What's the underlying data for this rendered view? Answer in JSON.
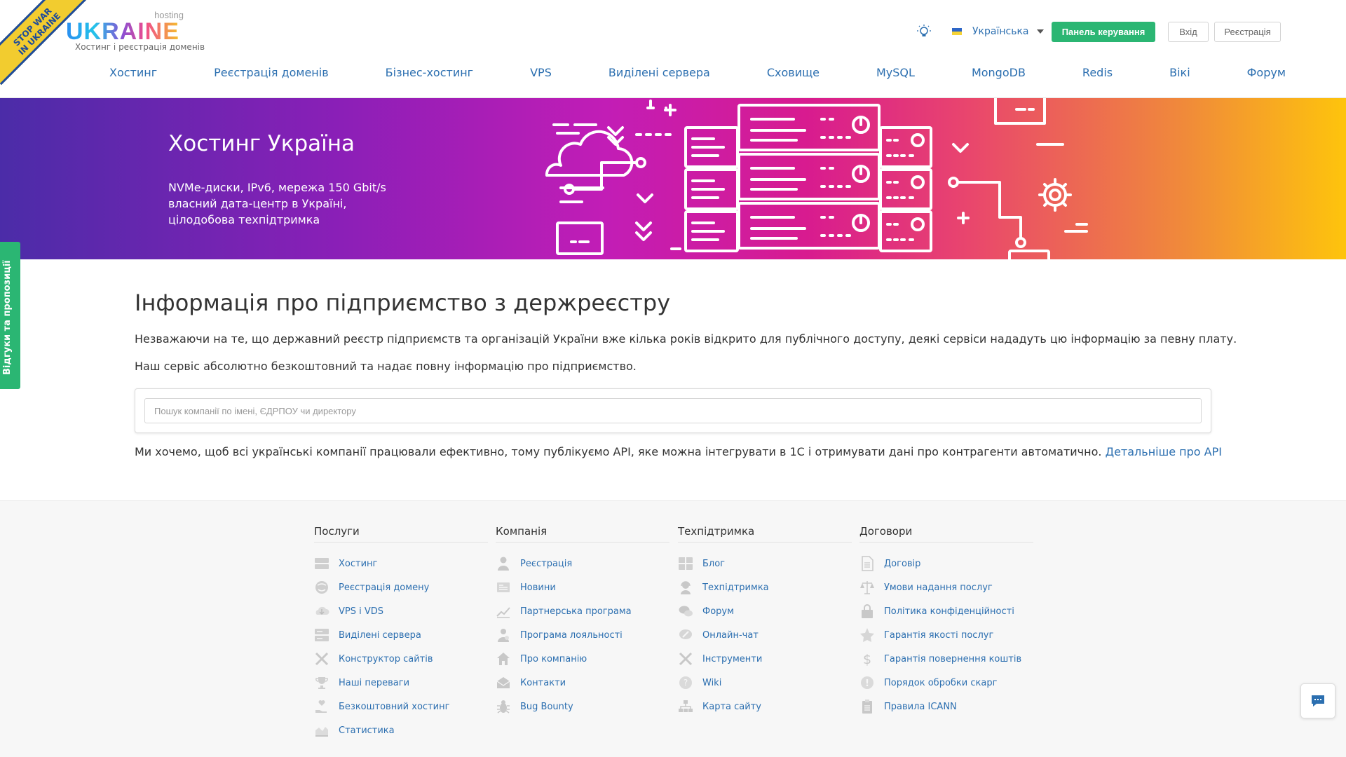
{
  "ribbon": {
    "line1": "STOP WAR",
    "line2": "IN UKRAINE"
  },
  "logo": {
    "hosting": "hosting",
    "word": "UKRAINE",
    "subtitle": "Хостинг і реєстрація доменів"
  },
  "topbar": {
    "language": "Українська",
    "panel_button": "Панель керування",
    "login_button": "Вхід",
    "register_button": "Реєстрація"
  },
  "nav": [
    "Хостинг",
    "Реєстрація доменів",
    "Бізнес-хостинг",
    "VPS",
    "Виділені сервера",
    "Сховище",
    "MySQL",
    "MongoDB",
    "Redis",
    "Вікі",
    "Форум"
  ],
  "hero": {
    "title": "Хостинг Україна",
    "line1": "NVMe-диски, IPv6, мережа 150 Gbit/s",
    "line2": "власний дата-центр в Україні,",
    "line3": "цілодобова техпідтримка"
  },
  "feedback_tab": "Відгуки та пропозиції",
  "main": {
    "title": "Інформація про підприємство з держреєстру",
    "para1": "Незважаючи на те, що державний реєстр підприємств та організацій України вже кілька років відкрито для публічного доступу, деякі сервіси нададуть цю інформацію за певну плату.",
    "para2": "Наш сервіс абсолютно безкоштовний та надає повну інформацію про підприємство.",
    "search_placeholder": "Пошук компанії по імені, ЄДРПОУ чи директору",
    "para3": "Ми хочемо, щоб всі українські компанії працювали ефективно, тому публікуємо API, яке можна інтегрувати в 1С і отримувати дані про контрагенти автоматично.",
    "api_link": "Детальніше про API"
  },
  "footer": {
    "columns": [
      {
        "title": "Послуги",
        "items": [
          {
            "label": "Хостинг",
            "icon": "server-icon"
          },
          {
            "label": "Реєстрація домену",
            "icon": "globe-icon"
          },
          {
            "label": "VPS і VDS",
            "icon": "cloud-download-icon"
          },
          {
            "label": "Виділені сервера",
            "icon": "server-rack-icon"
          },
          {
            "label": "Конструктор сайтів",
            "icon": "tools-icon"
          },
          {
            "label": "Наші переваги",
            "icon": "trophy-icon"
          },
          {
            "label": "Безкоштовний хостинг",
            "icon": "heart-hand-icon"
          },
          {
            "label": "Статистика",
            "icon": "chart-area-icon"
          }
        ]
      },
      {
        "title": "Компанія",
        "items": [
          {
            "label": "Реєстрація",
            "icon": "user-icon"
          },
          {
            "label": "Новини",
            "icon": "newspaper-icon"
          },
          {
            "label": "Партнерська програма",
            "icon": "line-chart-icon"
          },
          {
            "label": "Програма лояльності",
            "icon": "user-badge-icon"
          },
          {
            "label": "Про компанію",
            "icon": "home-icon"
          },
          {
            "label": "Контакти",
            "icon": "envelope-icon"
          },
          {
            "label": "Bug Bounty",
            "icon": "bug-icon"
          }
        ]
      },
      {
        "title": "Техпідтримка",
        "items": [
          {
            "label": "Блог",
            "icon": "grid-icon"
          },
          {
            "label": "Техпідтримка",
            "icon": "headset-icon"
          },
          {
            "label": "Форум",
            "icon": "chat-bubbles-icon"
          },
          {
            "label": "Онлайн-чат",
            "icon": "chat-pen-icon"
          },
          {
            "label": "Інструменти",
            "icon": "wrench-icon"
          },
          {
            "label": "Wiki",
            "icon": "question-icon"
          },
          {
            "label": "Карта сайту",
            "icon": "sitemap-icon"
          }
        ]
      },
      {
        "title": "Договори",
        "items": [
          {
            "label": "Договір",
            "icon": "document-icon"
          },
          {
            "label": "Умови надання послуг",
            "icon": "scales-icon"
          },
          {
            "label": "Політика конфіденційності",
            "icon": "lock-icon"
          },
          {
            "label": "Гарантія якості послуг",
            "icon": "star-icon"
          },
          {
            "label": "Гарантія повернення коштів",
            "icon": "dollar-icon"
          },
          {
            "label": "Порядок обробки скарг",
            "icon": "exclamation-icon"
          },
          {
            "label": "Правила ICANN",
            "icon": "clipboard-icon"
          }
        ]
      }
    ]
  },
  "colors": {
    "accent_green": "#2bb673",
    "link_blue": "#2c6fb0"
  }
}
